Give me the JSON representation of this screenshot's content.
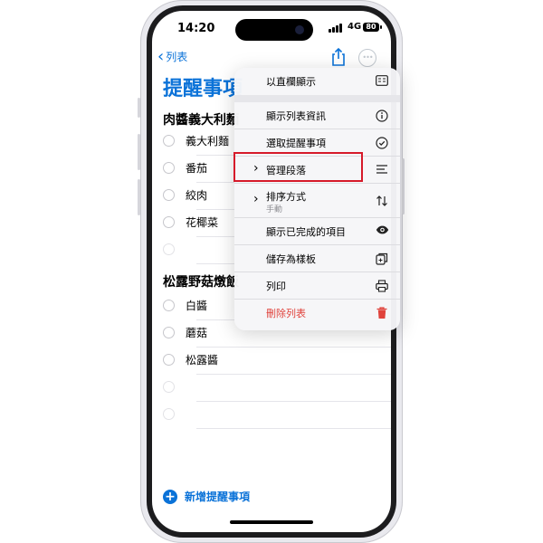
{
  "status_bar": {
    "time": "14:20",
    "network": "4G",
    "battery": "80"
  },
  "nav": {
    "back_label": "列表"
  },
  "page": {
    "title": "提醒事項"
  },
  "sections": [
    {
      "title": "肉醬義大利麵",
      "items": [
        "義大利麵",
        "番茄",
        "絞肉",
        "花椰菜"
      ]
    },
    {
      "title": "松露野菇燉飯",
      "items": [
        "白醬",
        "蘑菇",
        "松露醬"
      ]
    }
  ],
  "add_reminder_label": "新增提醒事項",
  "menu": {
    "items": [
      {
        "label": "以直欄顯示",
        "icon": "columns-icon"
      },
      {
        "label": "顯示列表資訊",
        "icon": "info-icon"
      },
      {
        "label": "選取提醒事項",
        "icon": "checkmark-circle-icon"
      },
      {
        "label": "管理段落",
        "icon": "list-icon",
        "highlighted": true
      },
      {
        "label": "排序方式",
        "sublabel": "手動",
        "icon": "sort-arrows-icon"
      },
      {
        "label": "顯示已完成的項目",
        "icon": "eye-icon"
      },
      {
        "label": "儲存為樣板",
        "icon": "template-icon"
      },
      {
        "label": "列印",
        "icon": "printer-icon"
      },
      {
        "label": "刪除列表",
        "icon": "trash-icon",
        "destructive": true
      }
    ]
  },
  "colors": {
    "accent": "#0a72d8",
    "destructive": "#e0433c",
    "highlight_box": "#d61a2a"
  }
}
